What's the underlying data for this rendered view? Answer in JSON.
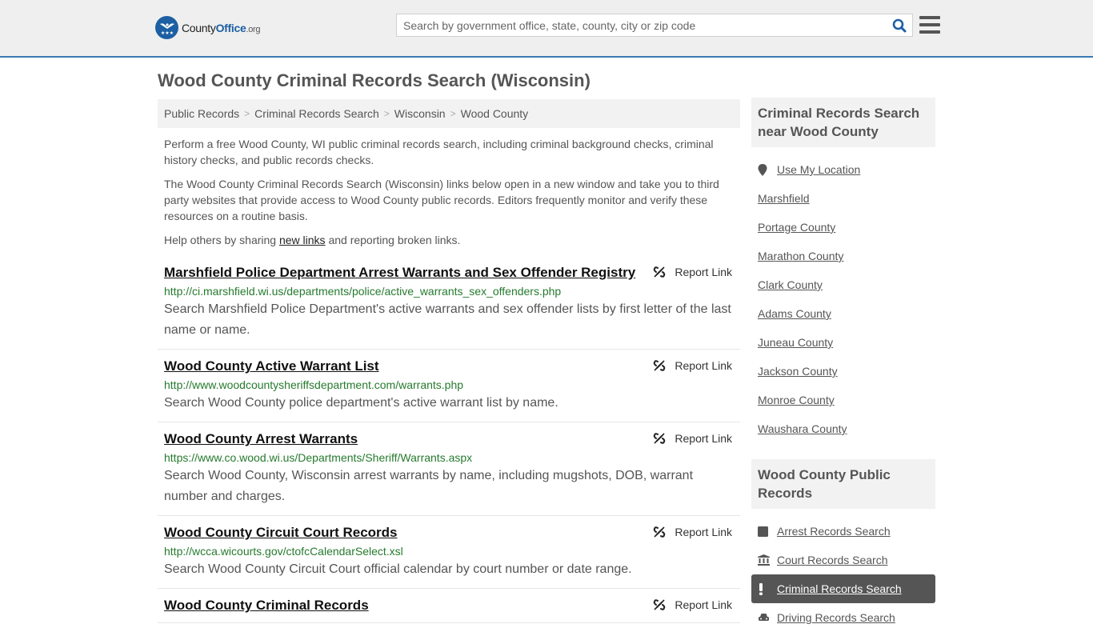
{
  "header": {
    "logo": {
      "prefix": "County",
      "bold": "Office",
      "suffix": ".org"
    },
    "search": {
      "placeholder": "Search by government office, state, county, city or zip code",
      "value": ""
    }
  },
  "page_title": "Wood County Criminal Records Search (Wisconsin)",
  "breadcrumb": [
    "Public Records",
    "Criminal Records Search",
    "Wisconsin",
    "Wood County"
  ],
  "intro": {
    "p1": "Perform a free Wood County, WI public criminal records search, including criminal background checks, criminal history checks, and public records checks.",
    "p2": "The Wood County Criminal Records Search (Wisconsin) links below open in a new window and take you to third party websites that provide access to Wood County public records. Editors frequently monitor and verify these resources on a routine basis.",
    "p3_before": "Help others by sharing ",
    "p3_link": "new links",
    "p3_after": " and reporting broken links."
  },
  "report_label": "Report Link",
  "results": [
    {
      "title": "Marshfield Police Department Arrest Warrants and Sex Offender Registry",
      "url": "http://ci.marshfield.wi.us/departments/police/active_warrants_sex_offenders.php",
      "desc": "Search Marshfield Police Department's active warrants and sex offender lists by first letter of the last name or name."
    },
    {
      "title": "Wood County Active Warrant List",
      "url": "http://www.woodcountysheriffsdepartment.com/warrants.php",
      "desc": "Search Wood County police department's active warrant list by name."
    },
    {
      "title": "Wood County Arrest Warrants",
      "url": "https://www.co.wood.wi.us/Departments/Sheriff/Warrants.aspx",
      "desc": "Search Wood County, Wisconsin arrest warrants by name, including mugshots, DOB, warrant number and charges."
    },
    {
      "title": "Wood County Circuit Court Records",
      "url": "http://wcca.wicourts.gov/ctofcCalendarSelect.xsl",
      "desc": "Search Wood County Circuit Court official calendar by court number or date range."
    },
    {
      "title": "Wood County Criminal Records",
      "url": "",
      "desc": ""
    }
  ],
  "sidebar": {
    "nearby": {
      "heading": "Criminal Records Search near Wood County",
      "location_label": "Use My Location",
      "items": [
        "Marshfield",
        "Portage County",
        "Marathon County",
        "Clark County",
        "Adams County",
        "Juneau County",
        "Jackson County",
        "Monroe County",
        "Waushara County"
      ]
    },
    "public_records": {
      "heading": "Wood County Public Records",
      "items": [
        {
          "label": "Arrest Records Search",
          "icon": "square-icon",
          "active": false
        },
        {
          "label": "Court Records Search",
          "icon": "courthouse-icon",
          "active": false
        },
        {
          "label": "Criminal Records Search",
          "icon": "exclamation-icon",
          "active": true
        },
        {
          "label": "Driving Records Search",
          "icon": "car-icon",
          "active": false
        }
      ]
    }
  },
  "colors": {
    "accent": "#3a7ab5",
    "brand": "#1d5fa3",
    "url_green": "#267a2e",
    "active_bg": "#555555"
  }
}
